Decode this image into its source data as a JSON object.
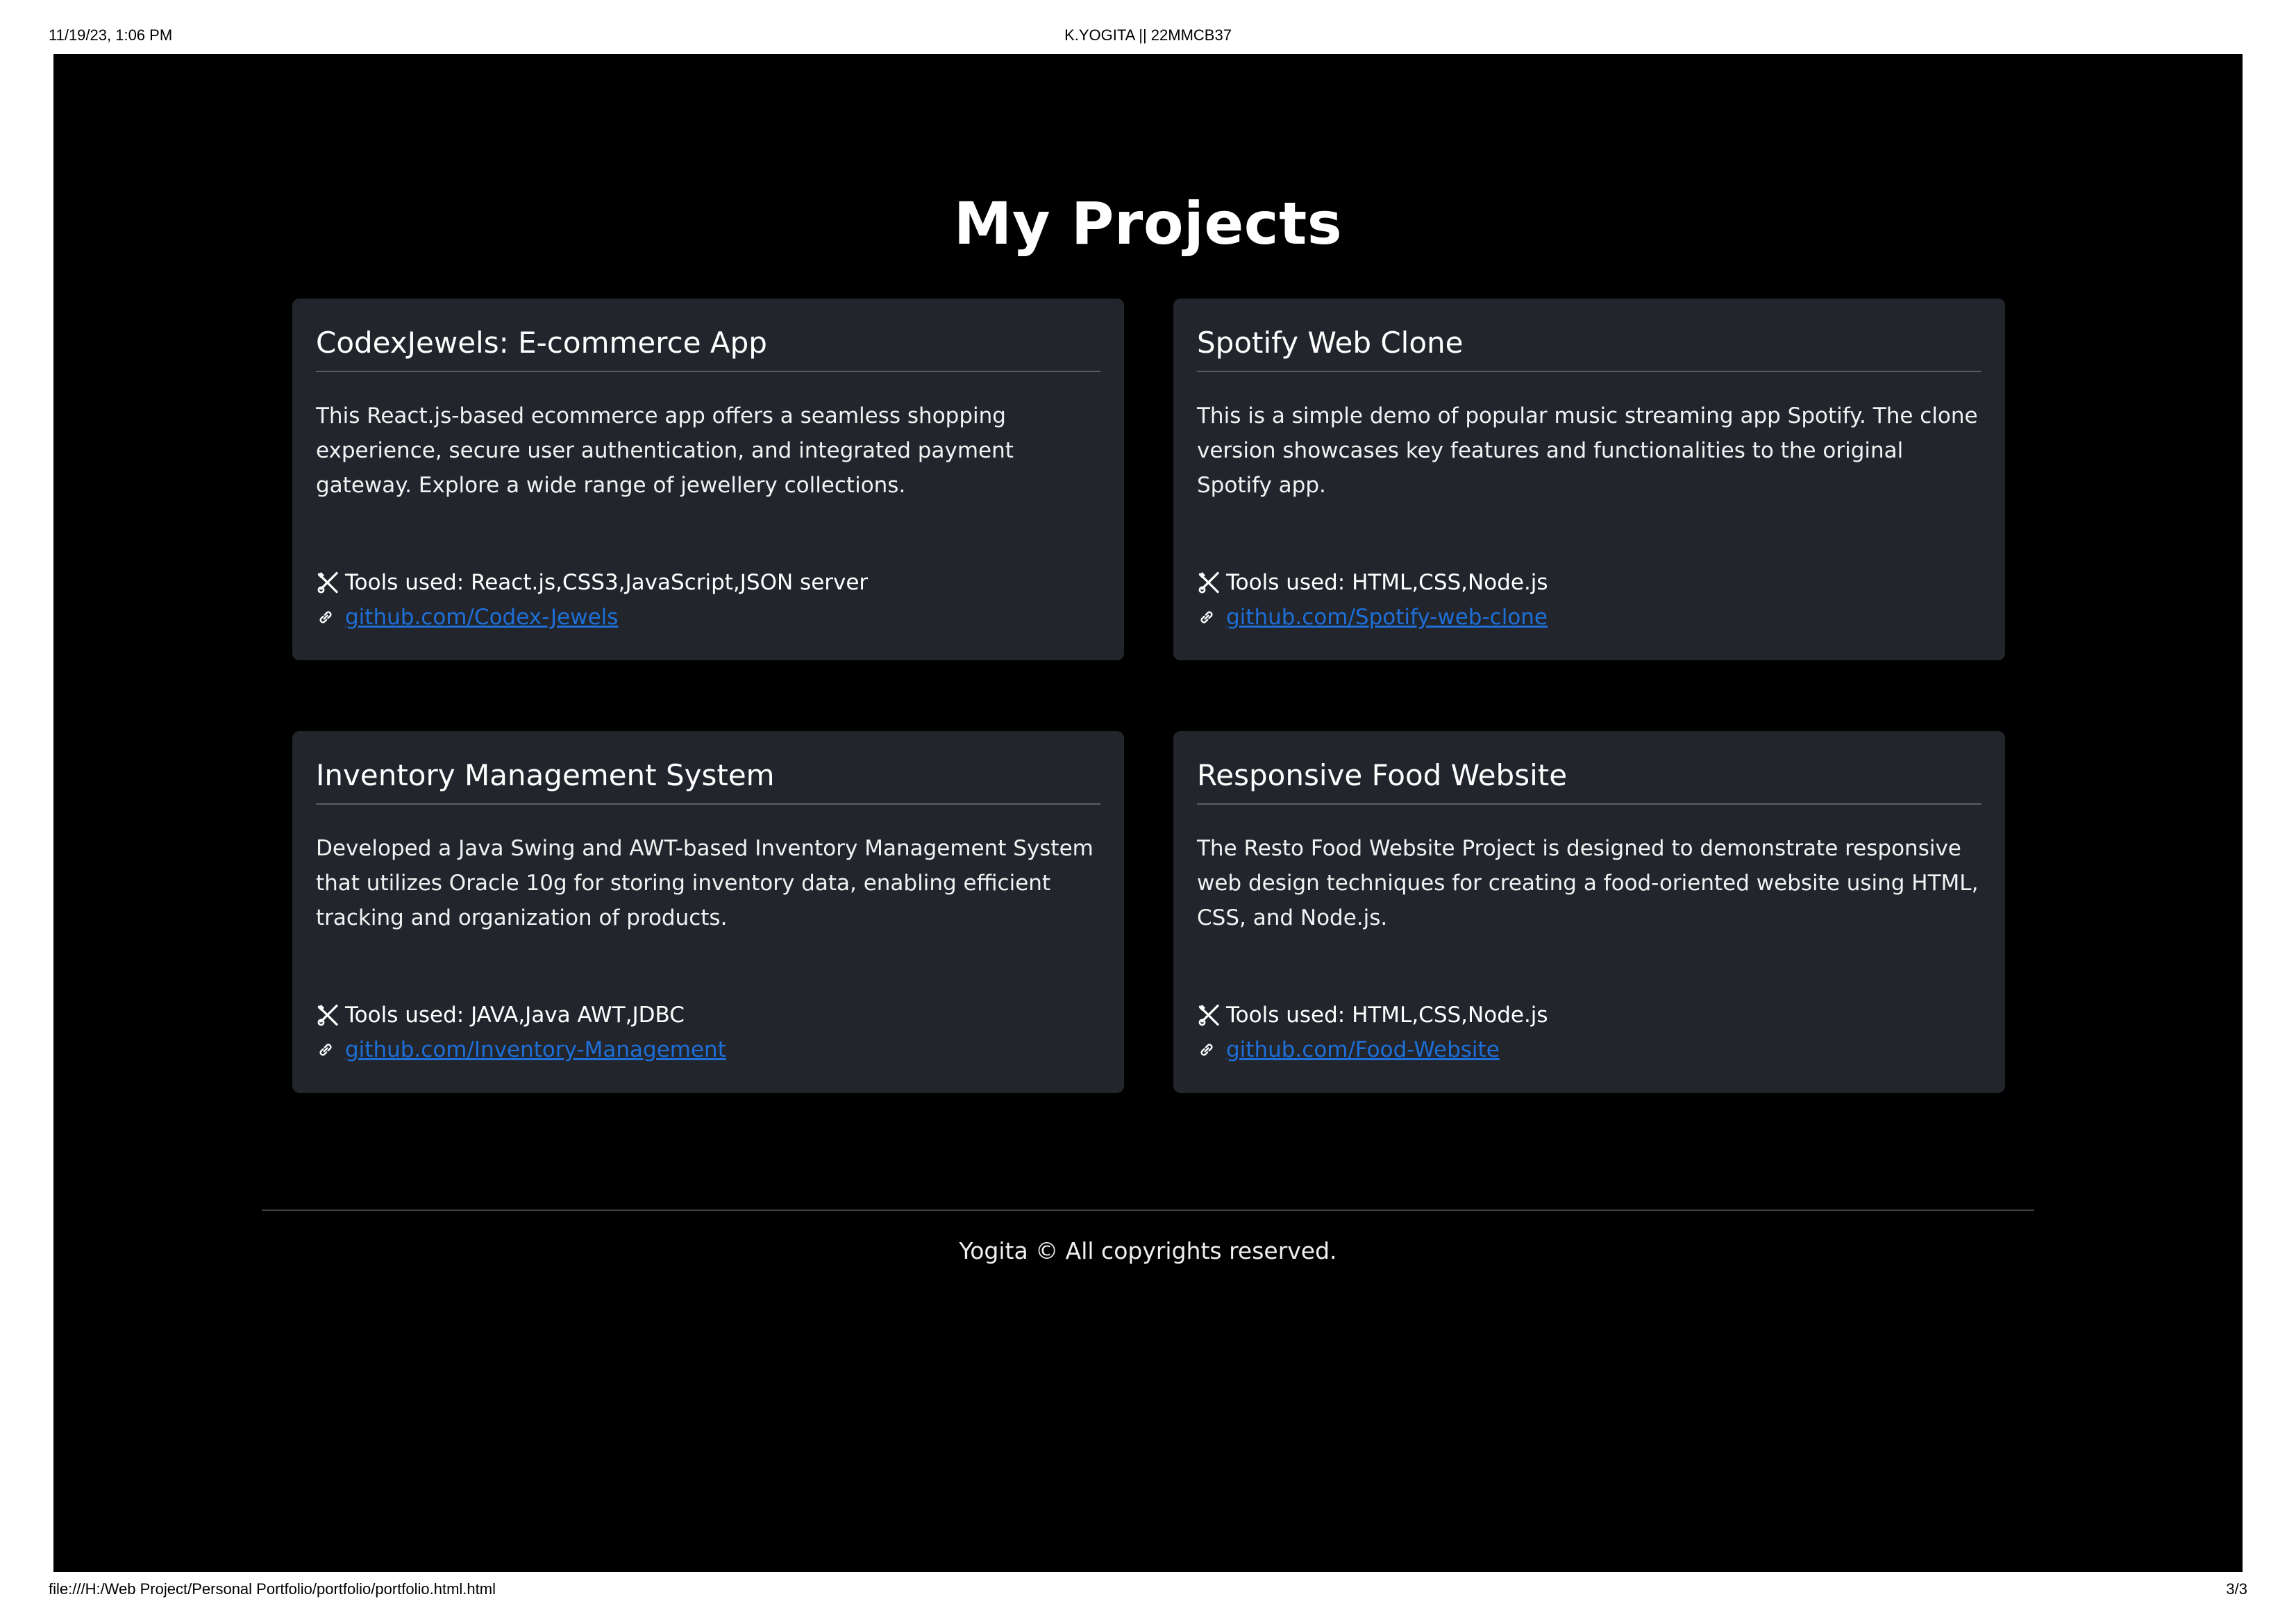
{
  "print_header": {
    "datetime": "11/19/23, 1:06 PM",
    "title": "K.YOGITA || 22MMCB37"
  },
  "print_footer": {
    "file_path": "file:///H:/Web Project/Personal Portfolio/portfolio/portfolio.html.html",
    "page_number": "3/3"
  },
  "main": {
    "heading": "My Projects",
    "projects": [
      {
        "title": "CodexJewels: E-commerce App",
        "description": "This React.js-based ecommerce app offers a seamless shopping experience, secure user authentication, and integrated payment gateway. Explore a wide range of jewellery collections.",
        "tools": "Tools used: React.js,CSS3,JavaScript,JSON server",
        "link": "github.com/Codex-Jewels"
      },
      {
        "title": "Spotify Web Clone",
        "description": "This is a simple demo of popular music streaming app Spotify. The clone version showcases key features and functionalities to the original Spotify app.",
        "tools": "Tools used: HTML,CSS,Node.js",
        "link": "github.com/Spotify-web-clone"
      },
      {
        "title": "Inventory Management System",
        "description": "Developed a Java Swing and AWT-based Inventory Management System that utilizes Oracle 10g for storing inventory data, enabling efficient tracking and organization of products.",
        "tools": "Tools used: JAVA,Java AWT,JDBC",
        "link": "github.com/Inventory-Management"
      },
      {
        "title": "Responsive Food Website",
        "description": "The Resto Food Website Project is designed to demonstrate responsive web design techniques for creating a food-oriented website using HTML, CSS, and Node.js.",
        "tools": "Tools used: HTML,CSS,Node.js",
        "link": "github.com/Food-Website"
      }
    ]
  },
  "footer": {
    "copyright": "Yogita © All copyrights reserved."
  },
  "colors": {
    "page_background": "#000000",
    "card_background": "#22252c",
    "link": "#1e6fd8",
    "text": "#ffffff"
  },
  "icons": {
    "tools": "tools-icon",
    "link": "link-icon"
  }
}
